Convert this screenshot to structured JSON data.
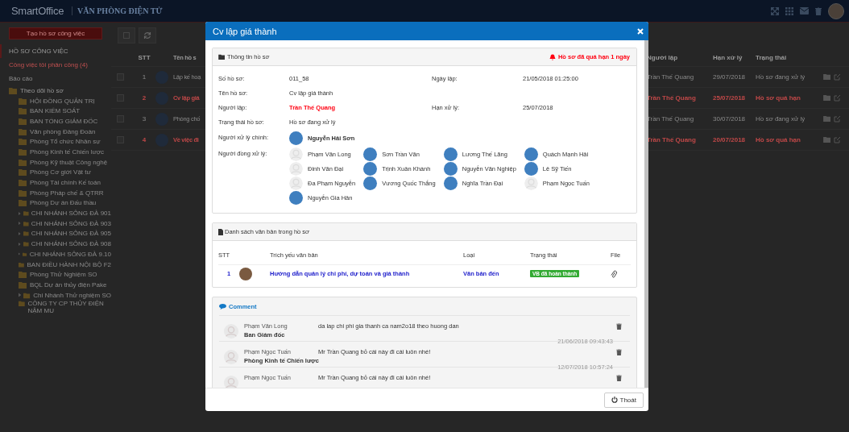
{
  "header": {
    "logo": "SmartOffice",
    "title": "VĂN PHÒNG ĐIỆN TỬ"
  },
  "toolbar": {
    "create_button": "Tạo hồ sơ công việc"
  },
  "sidebar": {
    "items": [
      {
        "label": "HỒ SƠ CÔNG VIỆC",
        "kind": "heading",
        "selected": true
      },
      {
        "label": "Công việc tôi phân công (4)",
        "kind": "alert",
        "selected": false
      },
      {
        "label": "Báo cáo",
        "kind": "plain",
        "selected": false
      }
    ],
    "tree": {
      "label": "Theo dõi hồ sơ",
      "children": [
        {
          "label": "HỘI ĐỒNG QUẢN TRỊ",
          "kind": "leaf"
        },
        {
          "label": "BAN KIỂM SOÁT",
          "kind": "leaf"
        },
        {
          "label": "BAN TỔNG GIÁM ĐỐC",
          "kind": "leaf"
        },
        {
          "label": "Văn phòng Đảng Đoàn",
          "kind": "leaf"
        },
        {
          "label": "Phòng Tổ chức Nhân sự",
          "kind": "leaf"
        },
        {
          "label": "Phòng Kinh tế Chiến lược",
          "kind": "leaf"
        },
        {
          "label": "Phòng Kỹ thuật Công nghệ",
          "kind": "leaf"
        },
        {
          "label": "Phòng Cơ giới Vật tư",
          "kind": "leaf"
        },
        {
          "label": "Phòng Tài chính Kế toán",
          "kind": "leaf"
        },
        {
          "label": "Phòng Pháp chế & QTRR",
          "kind": "leaf"
        },
        {
          "label": "Phòng Dự án Đấu thầu",
          "kind": "leaf"
        },
        {
          "label": "CHI NHÁNH SÔNG ĐÀ 901",
          "kind": "branch"
        },
        {
          "label": "CHI NHÁNH SÔNG ĐÀ 903",
          "kind": "branch"
        },
        {
          "label": "CHI NHÁNH SÔNG ĐÀ 905",
          "kind": "branch"
        },
        {
          "label": "CHI NHÁNH SÔNG ĐÀ 908",
          "kind": "branch"
        },
        {
          "label": "CHI NHÁNH SÔNG ĐÀ 9.10",
          "kind": "branch"
        },
        {
          "label": "BAN ĐIỀU HÀNH NỘI BỘ F2",
          "kind": "leaf"
        },
        {
          "label": "Phòng Thử Nghiệm SO",
          "kind": "leaf"
        },
        {
          "label": "BQL Dự án thủy điện Pake",
          "kind": "leaf"
        },
        {
          "label": "Chi Nhánh Thử nghiệm SO",
          "kind": "branch"
        },
        {
          "label": "CÔNG TY CP THỦY ĐIỆN NẬM MU",
          "kind": "leaf"
        }
      ]
    }
  },
  "table": {
    "columns": [
      "STT",
      "Tên hồ s",
      "Người lập",
      "Hạn xử lý",
      "Trạng thái"
    ],
    "rows": [
      {
        "stt": "1",
        "title": "Lập kế hoạ",
        "creator": "Trần Thế Quang",
        "deadline": "29/07/2018",
        "status": "Hồ sơ đang xử lý",
        "overdue": false
      },
      {
        "stt": "2",
        "title": "Cv lập giá",
        "creator": "Trần Thế Quang",
        "deadline": "25/07/2018",
        "status": "Hồ sơ quá hạn",
        "overdue": true
      },
      {
        "stt": "3",
        "title": "Phòng chố",
        "creator": "Trần Thế Quang",
        "deadline": "30/07/2018",
        "status": "Hồ sơ đang xử lý",
        "overdue": false
      },
      {
        "stt": "4",
        "title": "Về việc đi",
        "creator": "Trần Thế Quang",
        "deadline": "20/07/2018",
        "status": "Hồ sơ quá hạn",
        "overdue": true
      }
    ]
  },
  "modal": {
    "title": "Cv lập giá thành",
    "info": {
      "heading": "Thông tin hồ sơ",
      "alert": "Hồ sơ đã quá hạn 1 ngày",
      "rows": [
        [
          {
            "label": "Số hồ sơ:",
            "value": "011_58",
            "kind": "plain"
          },
          {
            "label": "Ngày lập:",
            "value": "21/05/2018 01:25:00",
            "kind": "plain"
          }
        ],
        [
          {
            "label": "Tên hồ sơ:",
            "value": "Cv lập giá thành",
            "kind": "plain"
          }
        ],
        [
          {
            "label": "Người lập:",
            "value": "Trần Thế Quang",
            "kind": "person"
          },
          {
            "label": "Hạn xử lý:",
            "value": "25/07/2018",
            "kind": "plain"
          }
        ],
        [
          {
            "label": "Trạng thái hồ sơ:",
            "value": "Hồ sơ đang xử lý",
            "kind": "plain"
          }
        ]
      ],
      "main_handler": {
        "label": "Người xử lý chính:",
        "name": "Nguyễn Hải Sơn"
      },
      "co_handlers": {
        "label": "Người đồng xử lý:",
        "people": [
          {
            "name": "Phạm Văn Long",
            "has_photo": false
          },
          {
            "name": "Sơn Trần Văn",
            "has_photo": true
          },
          {
            "name": "Lương Thế Lãng",
            "has_photo": true
          },
          {
            "name": "Quách Mạnh Hải",
            "has_photo": true
          },
          {
            "name": "Đinh Văn Đại",
            "has_photo": false
          },
          {
            "name": "Trịnh Xuân Khánh",
            "has_photo": true
          },
          {
            "name": "Nguyễn Văn Nghiệp",
            "has_photo": true
          },
          {
            "name": "Lê Sỹ Tiến",
            "has_photo": true
          },
          {
            "name": "Đa Phạm Nguyễn",
            "has_photo": false
          },
          {
            "name": "Vương Quốc Thắng",
            "has_photo": true
          },
          {
            "name": "Nghĩa Trần Đại",
            "has_photo": true
          },
          {
            "name": "Phạm Ngọc Tuấn",
            "has_photo": false
          },
          {
            "name": "Nguyễn Gia Hân",
            "has_photo": true
          }
        ]
      }
    },
    "documents": {
      "heading": "Danh sách văn bản trong hồ sơ",
      "columns": [
        "STT",
        "Trích yếu văn bản",
        "Loại",
        "Trạng thái",
        "File"
      ],
      "rows": [
        {
          "stt": "1",
          "title": "Hướng dẫn quản lý chi phí, dự toán và giá thành",
          "type": "Văn bản đến",
          "status": "VB đã hoàn thành"
        }
      ]
    },
    "comments": {
      "heading": "Comment",
      "items": [
        {
          "name": "Phạm Văn Long",
          "department": "Ban Giám đốc",
          "message": "da lap chi phi gia thanh ca nam2o18 theo huong dan",
          "time": "21/06/2018 09:43:43"
        },
        {
          "name": "Phạm Ngọc Tuấn",
          "department": "Phòng Kinh tế Chiến lược",
          "message": "Mr Trần Quang bỏ cái này đi cái luôn nhé!",
          "time": "12/07/2018 10:57:24"
        },
        {
          "name": "Phạm Ngọc Tuấn",
          "message": "Mr Trần Quang bỏ cái này đi cái luôn nhé!"
        }
      ]
    },
    "close_button": "Thoát"
  }
}
